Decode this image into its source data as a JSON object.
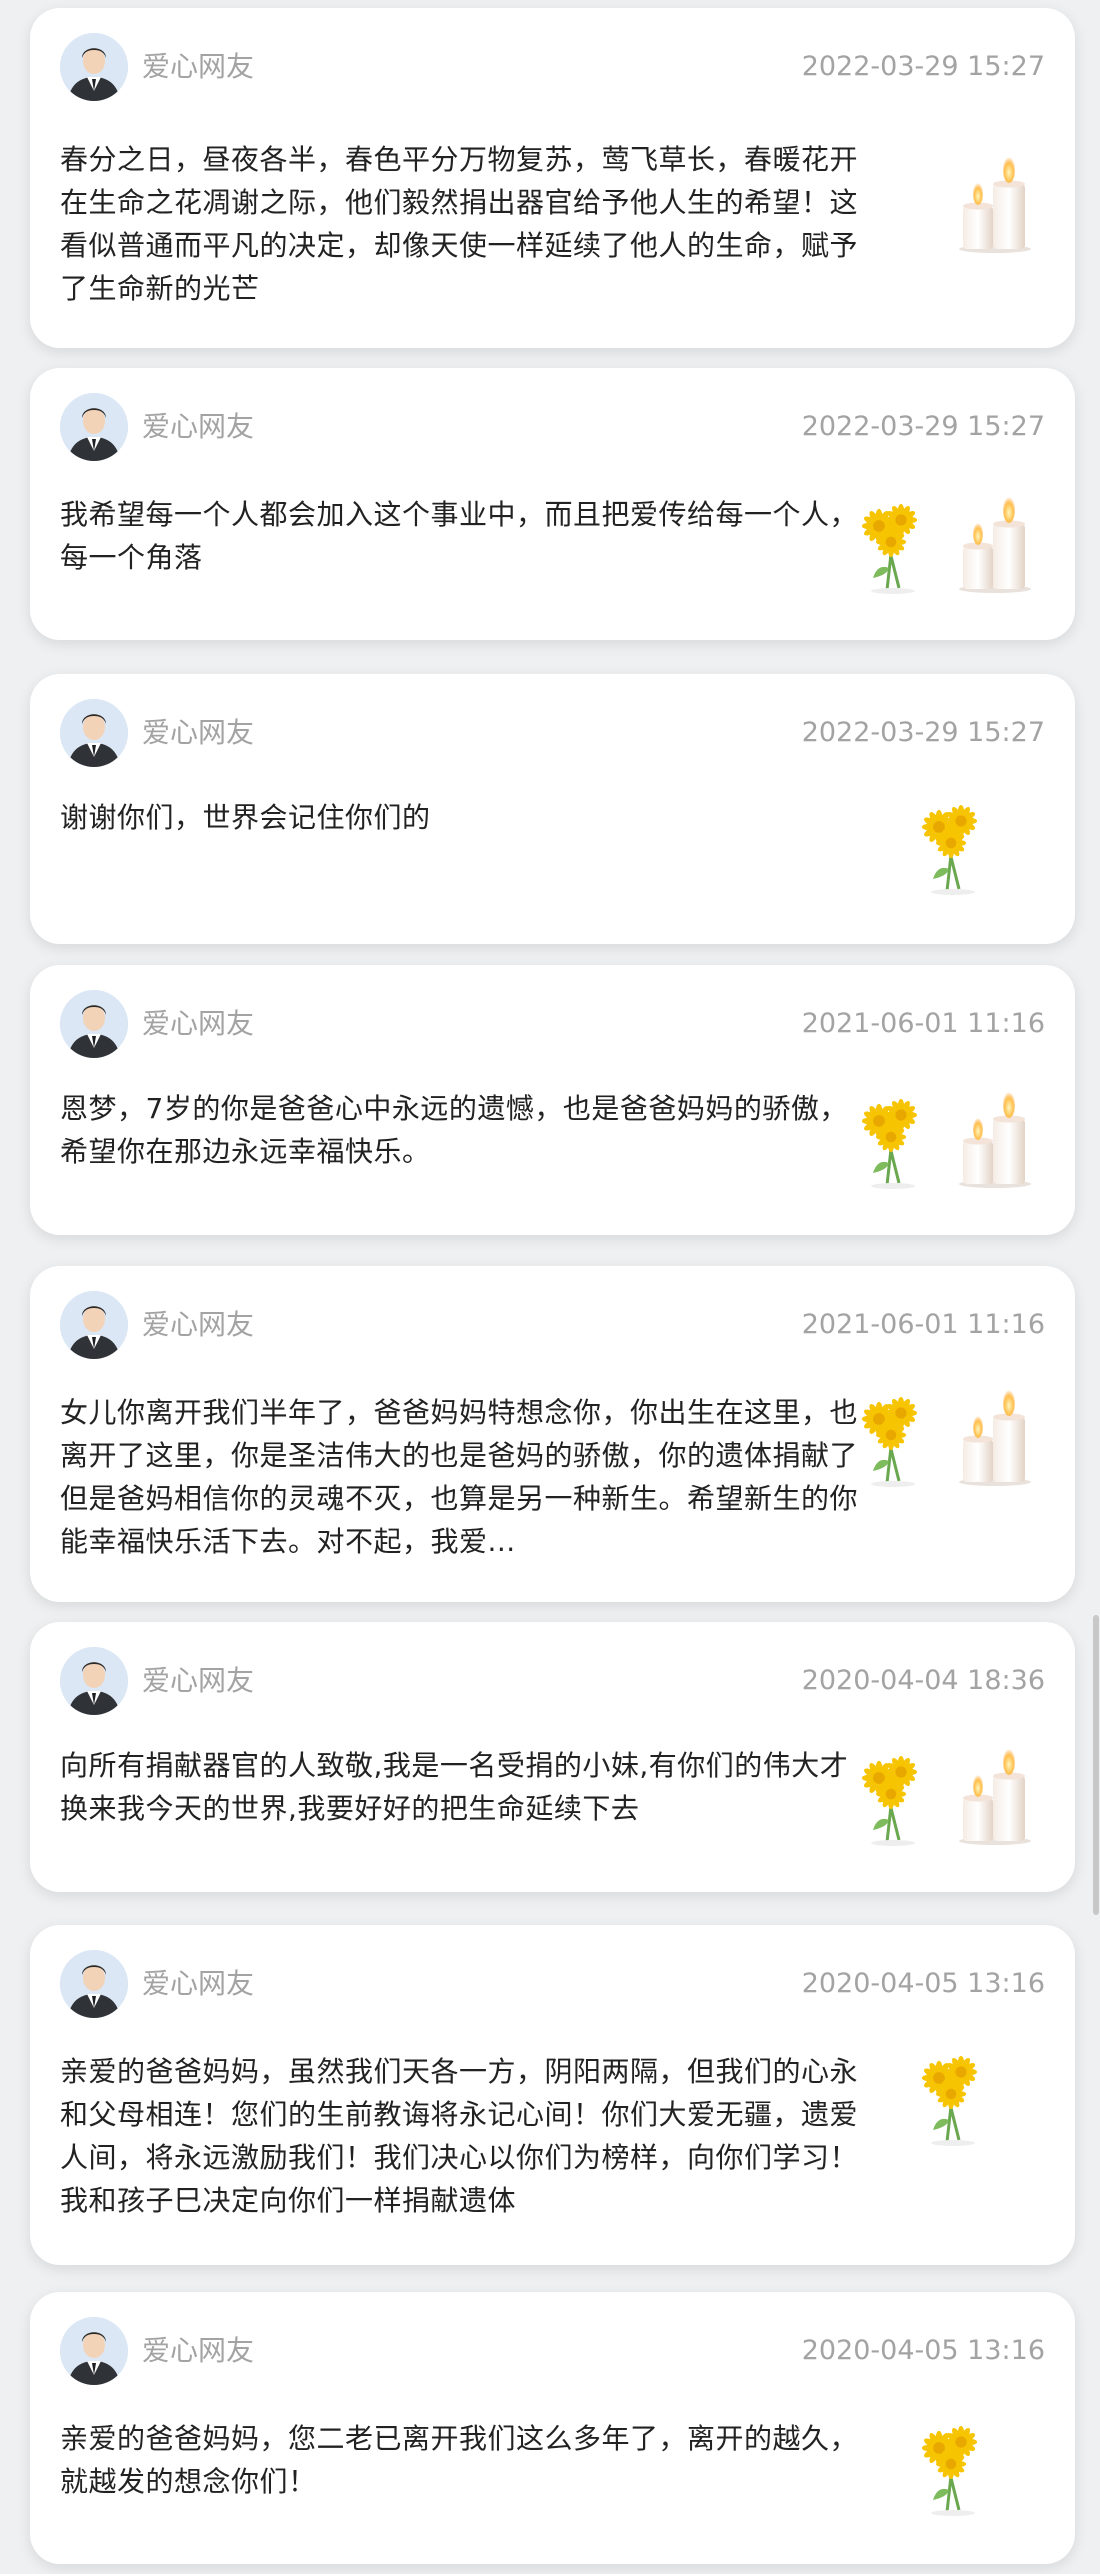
{
  "posts": [
    {
      "user": "爱心网友",
      "time": "2022-03-29 15:27",
      "message": "春分之日，昼夜各半，春色平分万物复苏，莺飞草长，春暖花开在生命之花凋谢之际，他们毅然捐出器官给予他人生的希望！这看似普通而平凡的决定，却像天使一样延续了他人的生命，赋予了生命新的光芒",
      "gifts": [
        "candle-icon"
      ]
    },
    {
      "user": "爱心网友",
      "time": "2022-03-29 15:27",
      "message": "我希望每一个人都会加入这个事业中，而且把爱传给每一个人，每一个角落",
      "gifts": [
        "chrysanthemum-icon",
        "candle-icon"
      ]
    },
    {
      "user": "爱心网友",
      "time": "2022-03-29 15:27",
      "message": "谢谢你们，世界会记住你们的",
      "gifts": [
        "chrysanthemum-icon"
      ]
    },
    {
      "user": "爱心网友",
      "time": "2021-06-01 11:16",
      "message": "恩梦，7岁的你是爸爸心中永远的遗憾，也是爸爸妈妈的骄傲，希望你在那边永远幸福快乐。",
      "gifts": [
        "chrysanthemum-icon",
        "candle-icon"
      ]
    },
    {
      "user": "爱心网友",
      "time": "2021-06-01 11:16",
      "message": "女儿你离开我们半年了，爸爸妈妈特想念你，你出生在这里，也离开了这里，你是圣洁伟大的也是爸妈的骄傲，你的遗体捐献了但是爸妈相信你的灵魂不灭，也算是另一种新生。希望新生的你能幸福快乐活下去。对不起，我爱...",
      "gifts": [
        "chrysanthemum-icon",
        "candle-icon"
      ]
    },
    {
      "user": "爱心网友",
      "time": "2020-04-04 18:36",
      "message": "向所有捐献器官的人致敬,我是一名受捐的小妹,有你们的伟大才换来我今天的世界,我要好好的把生命延续下去",
      "gifts": [
        "chrysanthemum-icon",
        "candle-icon"
      ]
    },
    {
      "user": "爱心网友",
      "time": "2020-04-05 13:16",
      "message": "亲爱的爸爸妈妈，虽然我们天各一方，阴阳两隔，但我们的心永和父母相连！您们的生前教诲将永记心间！你们大爱无疆，遗爱人间，将永远激励我们！我们决心以你们为榜样，向你们学习！我和孩子巳决定向你们一样捐献遗体",
      "gifts": [
        "chrysanthemum-icon"
      ]
    },
    {
      "user": "爱心网友",
      "time": "2020-04-05 13:16",
      "message": "亲爱的爸爸妈妈，您二老已离开我们这么多年了，离开的越久，就越发的想念你们！",
      "gifts": [
        "chrysanthemum-icon"
      ]
    }
  ],
  "colors": {
    "page_background": "#eef0f2",
    "card_background": "#ffffff",
    "meta_text": "#a3a3a3",
    "body_text": "#222222",
    "flower": "#f2c200"
  }
}
